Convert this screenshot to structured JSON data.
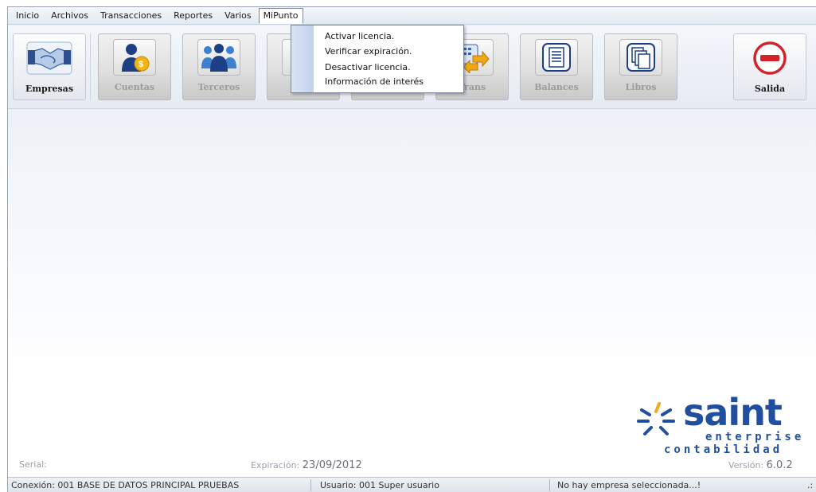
{
  "menubar": {
    "items": [
      {
        "label": "Inicio",
        "open": false
      },
      {
        "label": "Archivos",
        "open": false
      },
      {
        "label": "Transacciones",
        "open": false
      },
      {
        "label": "Reportes",
        "open": false
      },
      {
        "label": "Varios",
        "open": false
      },
      {
        "label": "MiPunto",
        "open": true
      }
    ]
  },
  "toolbar": {
    "buttons": [
      {
        "label": "Empresas",
        "icon": "handshake-icon",
        "enabled": true
      },
      {
        "label": "Cuentas",
        "icon": "user-coin-icon",
        "enabled": false
      },
      {
        "label": "Terceros",
        "icon": "group-icon",
        "enabled": false
      },
      {
        "label": "Trans",
        "icon": "transfer-icon",
        "enabled": false
      },
      {
        "label": "Balances",
        "icon": "document-icon",
        "enabled": false
      },
      {
        "label": "Libros",
        "icon": "books-icon",
        "enabled": false
      },
      {
        "label": "Salida",
        "icon": "exit-icon",
        "enabled": true
      }
    ]
  },
  "dropdown": {
    "items": [
      {
        "label": "Activar licencia."
      },
      {
        "label": "Verificar expiración."
      },
      {
        "label": "Desactivar licencia."
      },
      {
        "label": "Información de interés"
      }
    ]
  },
  "logo": {
    "brand": "saint",
    "line1": "enterprise",
    "line2": "contabilidad",
    "accent": "#1f4f9e",
    "star_color": "#f5a623"
  },
  "info": {
    "serial_label": "Serial:",
    "expiration_label": "Expiración:",
    "expiration_value": "23/09/2012",
    "version_label": "Versión:",
    "version_value": "6.0.2"
  },
  "status": {
    "connection": "Conexión:  001 BASE DE DATOS PRINCIPAL PRUEBAS",
    "user": "Usuario: 001 Super usuario",
    "company": "No hay empresa seleccionada...!",
    "grip": ".:"
  }
}
